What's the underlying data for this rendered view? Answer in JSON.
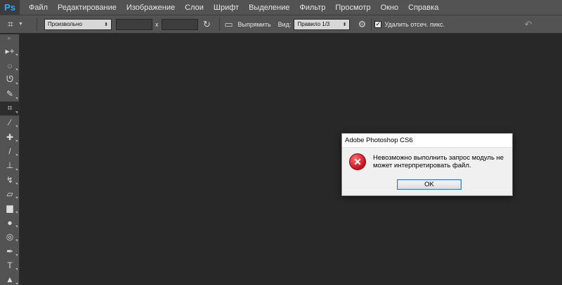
{
  "app": {
    "logo": "Ps",
    "title": "Adobe Photoshop CS6"
  },
  "menu": [
    "Файл",
    "Редактирование",
    "Изображение",
    "Слои",
    "Шрифт",
    "Выделение",
    "Фильтр",
    "Просмотр",
    "Окно",
    "Справка"
  ],
  "options": {
    "ratio_preset": "Произвольно",
    "width_value": "",
    "x_sep": "x",
    "height_value": "",
    "straighten_label": "Выпрямить",
    "view_label": "Вид:",
    "view_value": "Правило 1/3",
    "delete_cropped_label": "Удалить отсеч. пикс.",
    "delete_cropped_checked": true
  },
  "tools": [
    {
      "name": "move-tool",
      "glyph": "▸+"
    },
    {
      "name": "marquee-tool",
      "glyph": "◌"
    },
    {
      "name": "lasso-tool",
      "glyph": "ᘎ"
    },
    {
      "name": "quick-select-tool",
      "glyph": "✎"
    },
    {
      "name": "crop-tool",
      "glyph": "⌗",
      "active": true
    },
    {
      "name": "eyedropper-tool",
      "glyph": "⁄"
    },
    {
      "name": "healing-brush-tool",
      "glyph": "✚"
    },
    {
      "name": "brush-tool",
      "glyph": "/"
    },
    {
      "name": "clone-stamp-tool",
      "glyph": "⊥"
    },
    {
      "name": "history-brush-tool",
      "glyph": "↯"
    },
    {
      "name": "eraser-tool",
      "glyph": "▱"
    },
    {
      "name": "gradient-tool",
      "glyph": "▆"
    },
    {
      "name": "blur-tool",
      "glyph": "●"
    },
    {
      "name": "dodge-tool",
      "glyph": "◎"
    },
    {
      "name": "pen-tool",
      "glyph": "✒"
    },
    {
      "name": "type-tool",
      "glyph": "T"
    },
    {
      "name": "path-select-tool",
      "glyph": "▲"
    }
  ],
  "dialog": {
    "title": "Adobe Photoshop CS6",
    "message": "Невозможно выполнить запрос модуль не может интерпретировать файл.",
    "ok_label": "OK",
    "icon": "error-icon"
  },
  "colors": {
    "background": "#282828",
    "chrome": "#535353",
    "ps_blue": "#31a8ff",
    "error_red": "#c8101e"
  }
}
